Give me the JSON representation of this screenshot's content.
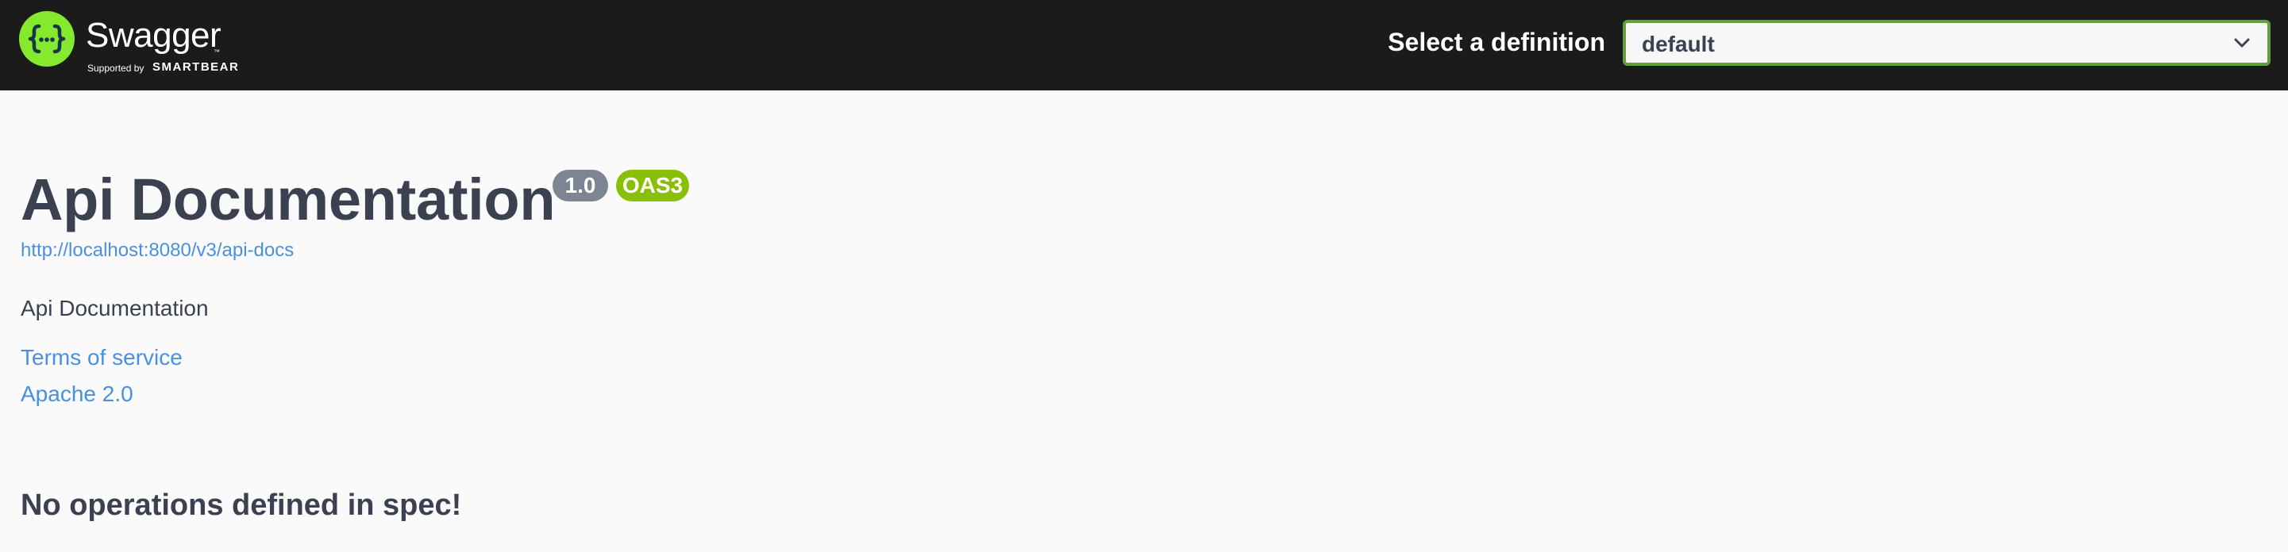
{
  "topbar": {
    "logo": {
      "wordmark": "Swagger",
      "trademark": "™",
      "supported_by": "Supported by",
      "company": "SMARTBEAR",
      "icon": "swagger-braces-icon",
      "brand_color": "#85ea2d"
    },
    "definition_label": "Select a definition",
    "definition_select": {
      "selected": "default",
      "icon": "chevron-down-icon",
      "border_color": "#62a03f"
    },
    "background_color": "#1b1b1b"
  },
  "info": {
    "title": "Api Documentation",
    "version_badge": "1.0",
    "oas_badge": "OAS3",
    "spec_url": "http://localhost:8080/v3/api-docs",
    "description": "Api Documentation",
    "terms_of_service": "Terms of service",
    "license": "Apache 2.0"
  },
  "operations": {
    "empty_message": "No operations defined in spec!"
  },
  "colors": {
    "text": "#3b4151",
    "link": "#4990e2",
    "version_badge": "#7d8492",
    "oas_badge": "#89bf04",
    "page_background": "#fafafa"
  }
}
